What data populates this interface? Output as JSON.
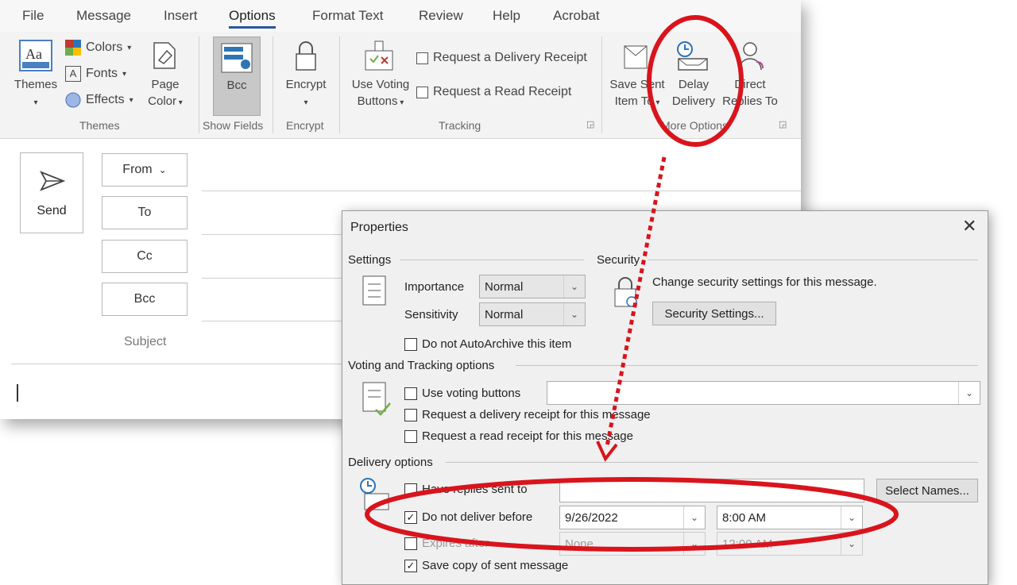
{
  "menu": {
    "tabs": [
      "File",
      "Message",
      "Insert",
      "Options",
      "Format Text",
      "Review",
      "Help",
      "Acrobat"
    ],
    "active": "Options"
  },
  "ribbon": {
    "themes_button": "Themes",
    "colors": "Colors",
    "fonts": "Fonts",
    "effects": "Effects",
    "page_color": [
      "Page",
      "Color"
    ],
    "themes_group": "Themes",
    "bcc": "Bcc",
    "show_fields_group": "Show Fields",
    "encrypt": "Encrypt",
    "encrypt_group": "Encrypt",
    "use_voting": [
      "Use Voting",
      "Buttons"
    ],
    "request_delivery": "Request a Delivery Receipt",
    "request_read": "Request a Read Receipt",
    "tracking_group": "Tracking",
    "save_sent": [
      "Save Sent",
      "Item To"
    ],
    "delay_delivery": [
      "Delay",
      "Delivery"
    ],
    "direct_replies": [
      "Direct",
      "Replies To"
    ],
    "more_options_group": "More Options"
  },
  "compose": {
    "send": "Send",
    "from": "From",
    "to": "To",
    "cc": "Cc",
    "bcc": "Bcc",
    "subject": "Subject"
  },
  "dialog": {
    "title": "Properties",
    "settings_header": "Settings",
    "security_header": "Security",
    "importance_label": "Importance",
    "importance_value": "Normal",
    "sensitivity_label": "Sensitivity",
    "sensitivity_value": "Normal",
    "security_text": "Change security settings for this message.",
    "security_button": "Security Settings...",
    "no_autoarchive": "Do not AutoArchive this item",
    "voting_header": "Voting and Tracking options",
    "use_voting": "Use voting buttons",
    "req_delivery": "Request a delivery receipt for this message",
    "req_read": "Request a read receipt for this message",
    "delivery_header": "Delivery options",
    "have_replies": "Have replies sent to",
    "select_names": "Select Names...",
    "do_not_deliver": "Do not deliver before",
    "deliver_date": "9/26/2022",
    "deliver_time": "8:00 AM",
    "expires_after": "Expires after",
    "expires_date": "None",
    "expires_time": "12:00 AM",
    "save_copy": "Save copy of sent message"
  },
  "colors": {
    "annotation": "#d9141c",
    "accent": "#2b579a"
  }
}
